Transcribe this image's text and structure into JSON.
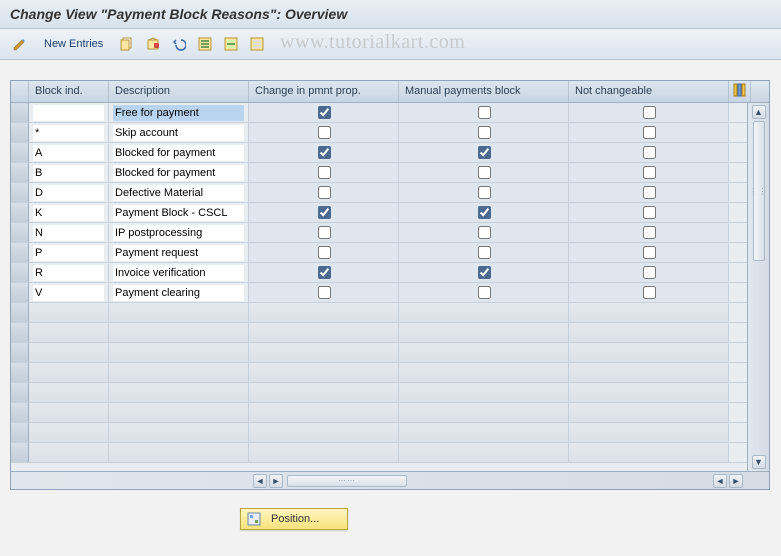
{
  "title": "Change View \"Payment Block Reasons\": Overview",
  "watermark": "www.tutorialkart.com",
  "toolbar": {
    "new_entries_label": "New Entries"
  },
  "table": {
    "headers": {
      "block_ind": "Block ind.",
      "description": "Description",
      "change_prop": "Change in pmnt prop.",
      "manual_block": "Manual payments block",
      "not_changeable": "Not changeable"
    },
    "rows": [
      {
        "ind": "",
        "desc": "Free for payment",
        "chg": true,
        "man": false,
        "not": false,
        "highlight": true
      },
      {
        "ind": "*",
        "desc": "Skip account",
        "chg": false,
        "man": false,
        "not": false
      },
      {
        "ind": "A",
        "desc": "Blocked for payment",
        "chg": true,
        "man": true,
        "not": false
      },
      {
        "ind": "B",
        "desc": "Blocked for payment",
        "chg": false,
        "man": false,
        "not": false
      },
      {
        "ind": "D",
        "desc": "Defective Material",
        "chg": false,
        "man": false,
        "not": false
      },
      {
        "ind": "K",
        "desc": "Payment Block - CSCL",
        "chg": true,
        "man": true,
        "not": false
      },
      {
        "ind": "N",
        "desc": "IP postprocessing",
        "chg": false,
        "man": false,
        "not": false
      },
      {
        "ind": "P",
        "desc": "Payment request",
        "chg": false,
        "man": false,
        "not": false
      },
      {
        "ind": "R",
        "desc": "Invoice verification",
        "chg": true,
        "man": true,
        "not": false
      },
      {
        "ind": "V",
        "desc": "Payment clearing",
        "chg": false,
        "man": false,
        "not": false
      }
    ],
    "empty_rows": 8
  },
  "footer": {
    "position_label": "Position..."
  }
}
